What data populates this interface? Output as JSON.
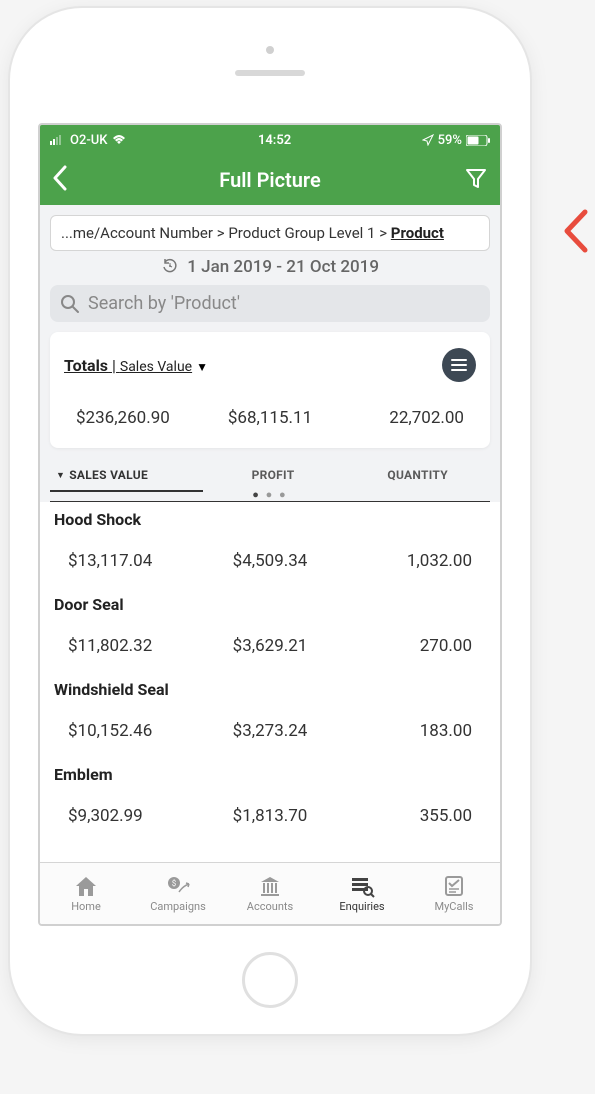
{
  "status": {
    "carrier": "O2-UK",
    "time": "14:52",
    "battery": "59%"
  },
  "nav": {
    "title": "Full Picture"
  },
  "breadcrumb": {
    "prefix_truncated": "...me/Account Number",
    "mid": "Product Group Level 1",
    "current": "Product",
    "sep": ">"
  },
  "date_range": "1 Jan 2019 - 21 Oct 2019",
  "search": {
    "placeholder": "Search by 'Product'"
  },
  "totals": {
    "label": "Totals",
    "sub": "Sales Value",
    "sales_value": "$236,260.90",
    "profit": "$68,115.11",
    "quantity": "22,702.00"
  },
  "tabs": {
    "sales_value": "SALES VALUE",
    "profit": "PROFIT",
    "quantity": "QUANTITY"
  },
  "products": [
    {
      "name": "Hood Shock",
      "sales_value": "$13,117.04",
      "profit": "$4,509.34",
      "quantity": "1,032.00"
    },
    {
      "name": "Door Seal",
      "sales_value": "$11,802.32",
      "profit": "$3,629.21",
      "quantity": "270.00"
    },
    {
      "name": "Windshield Seal",
      "sales_value": "$10,152.46",
      "profit": "$3,273.24",
      "quantity": "183.00"
    },
    {
      "name": "Emblem",
      "sales_value": "$9,302.99",
      "profit": "$1,813.70",
      "quantity": "355.00"
    }
  ],
  "bottom_nav": {
    "home": "Home",
    "campaigns": "Campaigns",
    "accounts": "Accounts",
    "enquiries": "Enquiries",
    "mycalls": "MyCalls"
  },
  "chart_data": {
    "type": "table",
    "columns": [
      "SALES VALUE",
      "PROFIT",
      "QUANTITY"
    ],
    "rows": [
      {
        "label": "Totals",
        "values": [
          236260.9,
          68115.11,
          22702.0
        ]
      },
      {
        "label": "Hood Shock",
        "values": [
          13117.04,
          4509.34,
          1032.0
        ]
      },
      {
        "label": "Door Seal",
        "values": [
          11802.32,
          3629.21,
          270.0
        ]
      },
      {
        "label": "Windshield Seal",
        "values": [
          10152.46,
          3273.24,
          183.0
        ]
      },
      {
        "label": "Emblem",
        "values": [
          9302.99,
          1813.7,
          355.0
        ]
      }
    ],
    "date_range": "1 Jan 2019 - 21 Oct 2019",
    "sort_by": "SALES VALUE",
    "sort_dir": "desc"
  }
}
